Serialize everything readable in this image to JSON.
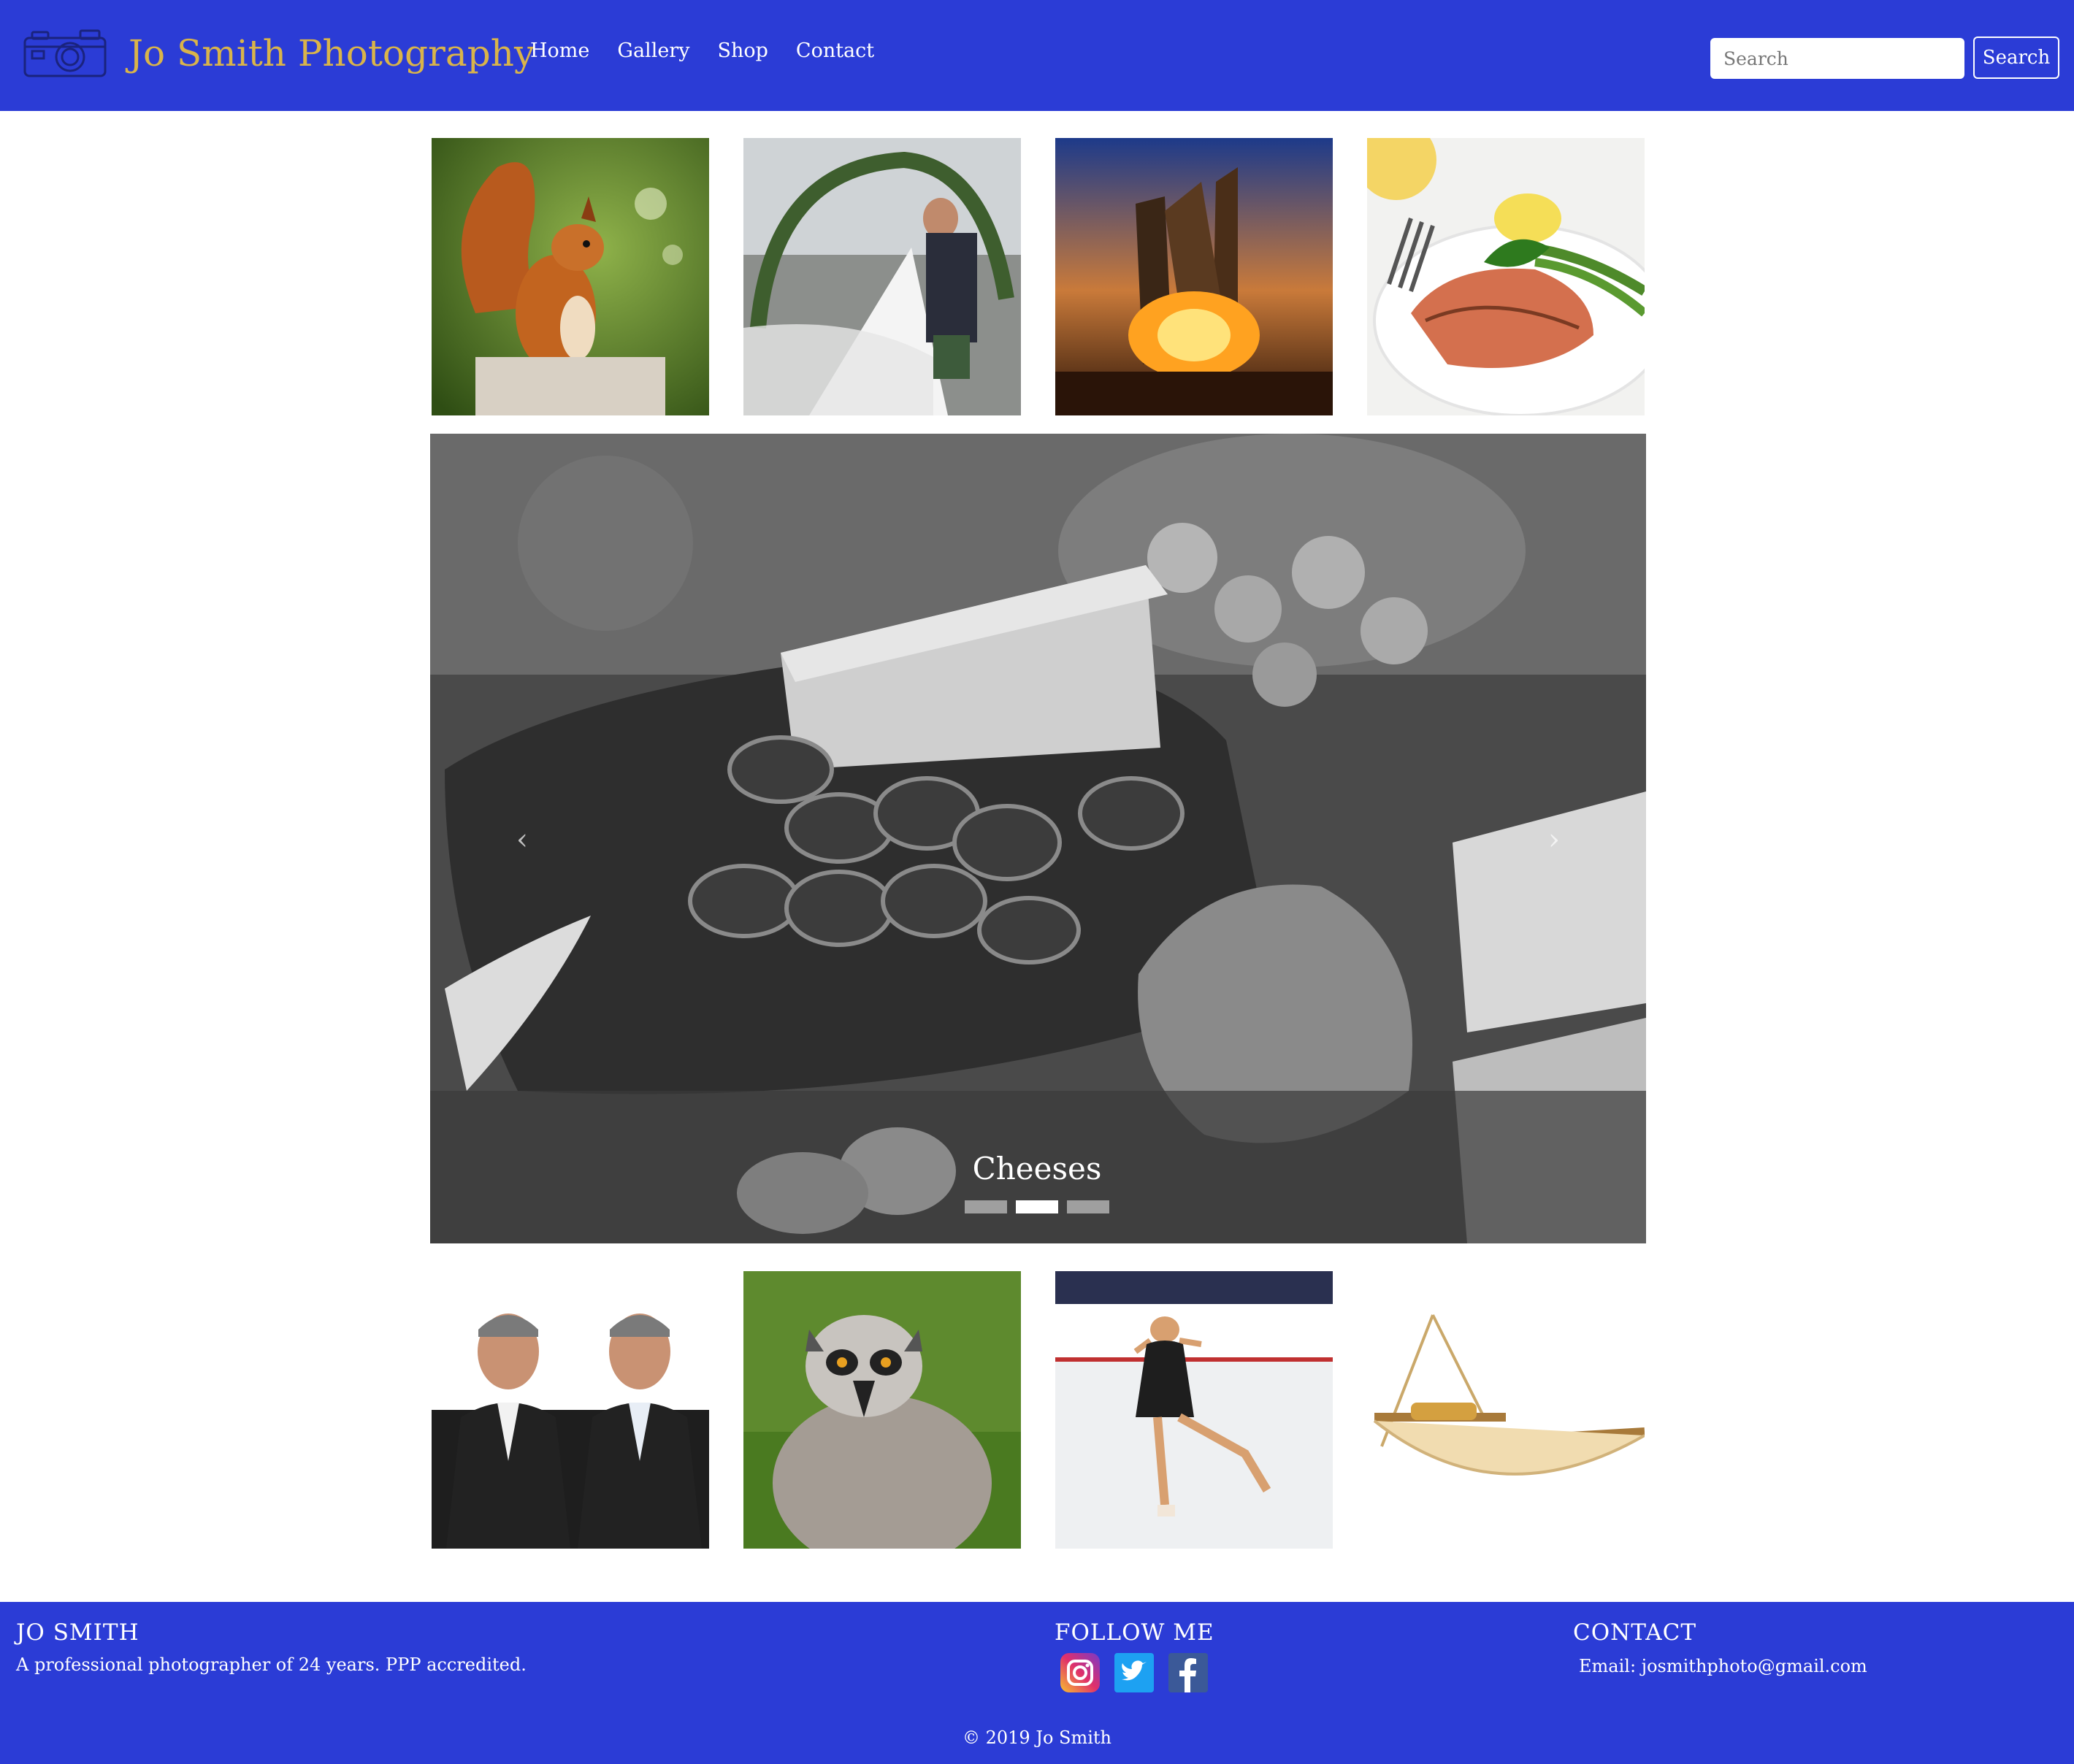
{
  "header": {
    "logo_icon": "camera-icon",
    "brand": "Jo Smith Photography",
    "nav": [
      {
        "label": "Home"
      },
      {
        "label": "Gallery"
      },
      {
        "label": "Shop"
      },
      {
        "label": "Contact"
      }
    ],
    "search": {
      "placeholder": "Search",
      "button_label": "Search"
    }
  },
  "gallery_top": [
    {
      "subject": "squirrel"
    },
    {
      "subject": "wedding couple"
    },
    {
      "subject": "bonfire"
    },
    {
      "subject": "salmon dish"
    }
  ],
  "carousel": {
    "caption": "Cheeses",
    "slides": 3,
    "active_index": 1
  },
  "gallery_bottom": [
    {
      "subject": "two men in suits"
    },
    {
      "subject": "lemur"
    },
    {
      "subject": "figure skater"
    },
    {
      "subject": "hammock"
    }
  ],
  "footer": {
    "about": {
      "heading": "JO SMITH",
      "text": "A professional photographer of 24 years. PPP accredited."
    },
    "follow": {
      "heading": "FOLLOW ME",
      "icons": [
        "instagram-icon",
        "twitter-icon",
        "facebook-icon"
      ]
    },
    "contact": {
      "heading": "CONTACT",
      "email": "Email: josmithphoto@gmail.com"
    },
    "copyright": "© 2019 Jo Smith"
  },
  "colors": {
    "brand_blue": "#2b3cd6",
    "brand_gold": "#d9b44a"
  }
}
